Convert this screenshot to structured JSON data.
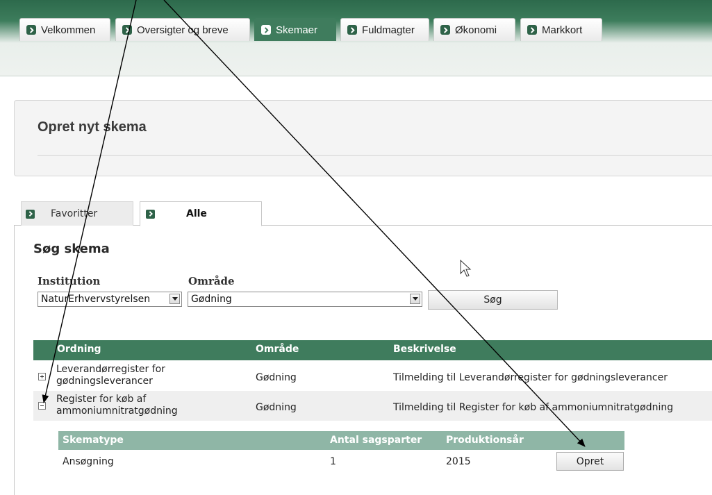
{
  "nav": {
    "tabs": [
      {
        "label": "Velkommen"
      },
      {
        "label": "Oversigter og breve"
      },
      {
        "label": "Skemaer",
        "active": true
      },
      {
        "label": "Fuldmagter"
      },
      {
        "label": "Økonomi"
      },
      {
        "label": "Markkort"
      }
    ]
  },
  "panel": {
    "title": "Opret nyt skema"
  },
  "inner_tabs": [
    {
      "label": "Favoritter"
    },
    {
      "label": "Alle",
      "active": true
    }
  ],
  "search": {
    "heading": "Søg skema",
    "institution_label": "Institution",
    "institution_value": "NaturErhvervstyrelsen",
    "area_label": "Område",
    "area_value": "Gødning",
    "button_label": "Søg"
  },
  "table": {
    "headers": [
      "Ordning",
      "Område",
      "Beskrivelse"
    ],
    "rows": [
      {
        "ordning_line1": "Leverandørregister for",
        "ordning_line2": "gødningsleverancer",
        "omraade": "Gødning",
        "beskrivelse": "Tilmelding til Leverandørregister for gødningsleverancer",
        "expanded": false
      },
      {
        "ordning_line1": "Register for køb af",
        "ordning_line2": "ammoniumnitratgødning",
        "omraade": "Gødning",
        "beskrivelse": "Tilmelding til Register for køb af ammoniumnitratgødning",
        "expanded": true
      }
    ]
  },
  "subtable": {
    "headers": [
      "Skematype",
      "Antal sagsparter",
      "Produktionsår"
    ],
    "rows": [
      {
        "skematype": "Ansøgning",
        "antal": "1",
        "aar": "2015",
        "button_label": "Opret"
      }
    ]
  },
  "colors": {
    "brand_green": "#3f7c5d",
    "sub_header_green": "#8fb6a6",
    "row_alt": "#efefef"
  }
}
